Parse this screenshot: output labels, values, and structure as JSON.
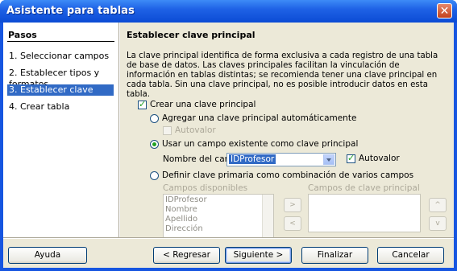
{
  "window": {
    "title": "Asistente para tablas"
  },
  "sidebar": {
    "heading": "Pasos",
    "steps": [
      {
        "label": "1.  Seleccionar campos"
      },
      {
        "label": "2.  Establecer tipos y formatos"
      },
      {
        "label": "3.  Establecer clave principal",
        "active": true
      },
      {
        "label": "4.  Crear tabla"
      }
    ]
  },
  "main": {
    "heading": "Establecer clave principal",
    "description": "La clave principal identifica de forma exclusiva a cada registro de una tabla de base de datos. Las claves principales facilitan la vinculación de información en tablas distintas; se recomienda tener una clave principal en cada tabla. Sin una clave principal, no es posible introducir datos en esta tabla.",
    "create_pk_label": "Crear una clave principal",
    "create_pk_checked": true,
    "option_auto_label": "Agregar una clave principal automáticamente",
    "auto_value_1_label": "Autovalor",
    "option_existing_label": "Usar un campo existente como clave principal",
    "field_name_label": "Nombre del campo",
    "field_name_value": "IDProfesor",
    "auto_value_2_label": "Autovalor",
    "auto_value_2_checked": true,
    "option_combo_label": "Definir clave primaria como combinación de varios campos",
    "available_fields_label": "Campos disponibles",
    "available_fields": [
      "IDProfesor",
      "Nombre",
      "Apellido",
      "Dirección"
    ],
    "pk_fields_label": "Campos de clave principal",
    "pk_fields": [],
    "add_button": ">",
    "remove_button": "<",
    "up_button": "^",
    "down_button": "v"
  },
  "footer": {
    "help": "Ayuda",
    "back": "< Regresar",
    "next": "Siguiente >",
    "finish": "Finalizar",
    "cancel": "Cancelar"
  }
}
